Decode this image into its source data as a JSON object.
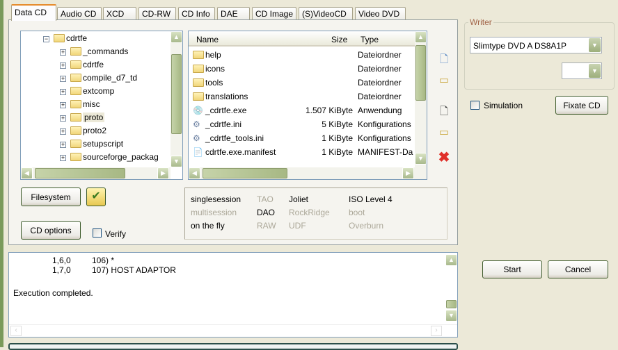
{
  "tabs": [
    "Data CD",
    "Audio CD",
    "XCD",
    "CD-RW",
    "CD Info",
    "DAE",
    "CD Image",
    "(S)VideoCD",
    "Video DVD"
  ],
  "tree": {
    "root": "cdrtfe",
    "items": [
      "_commands",
      "cdrtfe",
      "compile_d7_td",
      "extcomp",
      "misc",
      "proto",
      "proto2",
      "setupscript",
      "sourceforge_packag"
    ],
    "selected": "proto"
  },
  "files": {
    "headers": {
      "name": "Name",
      "size": "Size",
      "type": "Type"
    },
    "rows": [
      {
        "name": "help",
        "size": "",
        "type": "Dateiordner",
        "icon": "folder"
      },
      {
        "name": "icons",
        "size": "",
        "type": "Dateiordner",
        "icon": "folder"
      },
      {
        "name": "tools",
        "size": "",
        "type": "Dateiordner",
        "icon": "folder"
      },
      {
        "name": "translations",
        "size": "",
        "type": "Dateiordner",
        "icon": "folder"
      },
      {
        "name": "_cdrtfe.exe",
        "size": "1.507 KiByte",
        "type": "Anwendung",
        "icon": "exe"
      },
      {
        "name": "_cdrtfe.ini",
        "size": "5 KiByte",
        "type": "Konfigurations",
        "icon": "ini"
      },
      {
        "name": "_cdrtfe_tools.ini",
        "size": "1 KiByte",
        "type": "Konfigurations",
        "icon": "ini"
      },
      {
        "name": "cdrtfe.exe.manifest",
        "size": "1 KiByte",
        "type": "MANIFEST-Da",
        "icon": "manifest"
      }
    ]
  },
  "buttons": {
    "filesystem": "Filesystem",
    "cd_options": "CD options",
    "verify": "Verify",
    "start": "Start",
    "cancel": "Cancel",
    "fixate": "Fixate CD",
    "simulation": "Simulation"
  },
  "options": [
    [
      "singlesession",
      "TAO",
      "Joliet",
      "ISO Level 4"
    ],
    [
      "multisession",
      "DAO",
      "RockRidge",
      "boot"
    ],
    [
      "on the fly",
      "RAW",
      "UDF",
      "Overburn"
    ]
  ],
  "log": {
    "lines": [
      [
        "1,6,0",
        "106) *"
      ],
      [
        "1,7,0",
        "107) HOST ADAPTOR"
      ]
    ],
    "status": "Execution completed."
  },
  "writer": {
    "label": "Writer",
    "device": "Slimtype DVD A  DS8A1P",
    "speed": ""
  }
}
